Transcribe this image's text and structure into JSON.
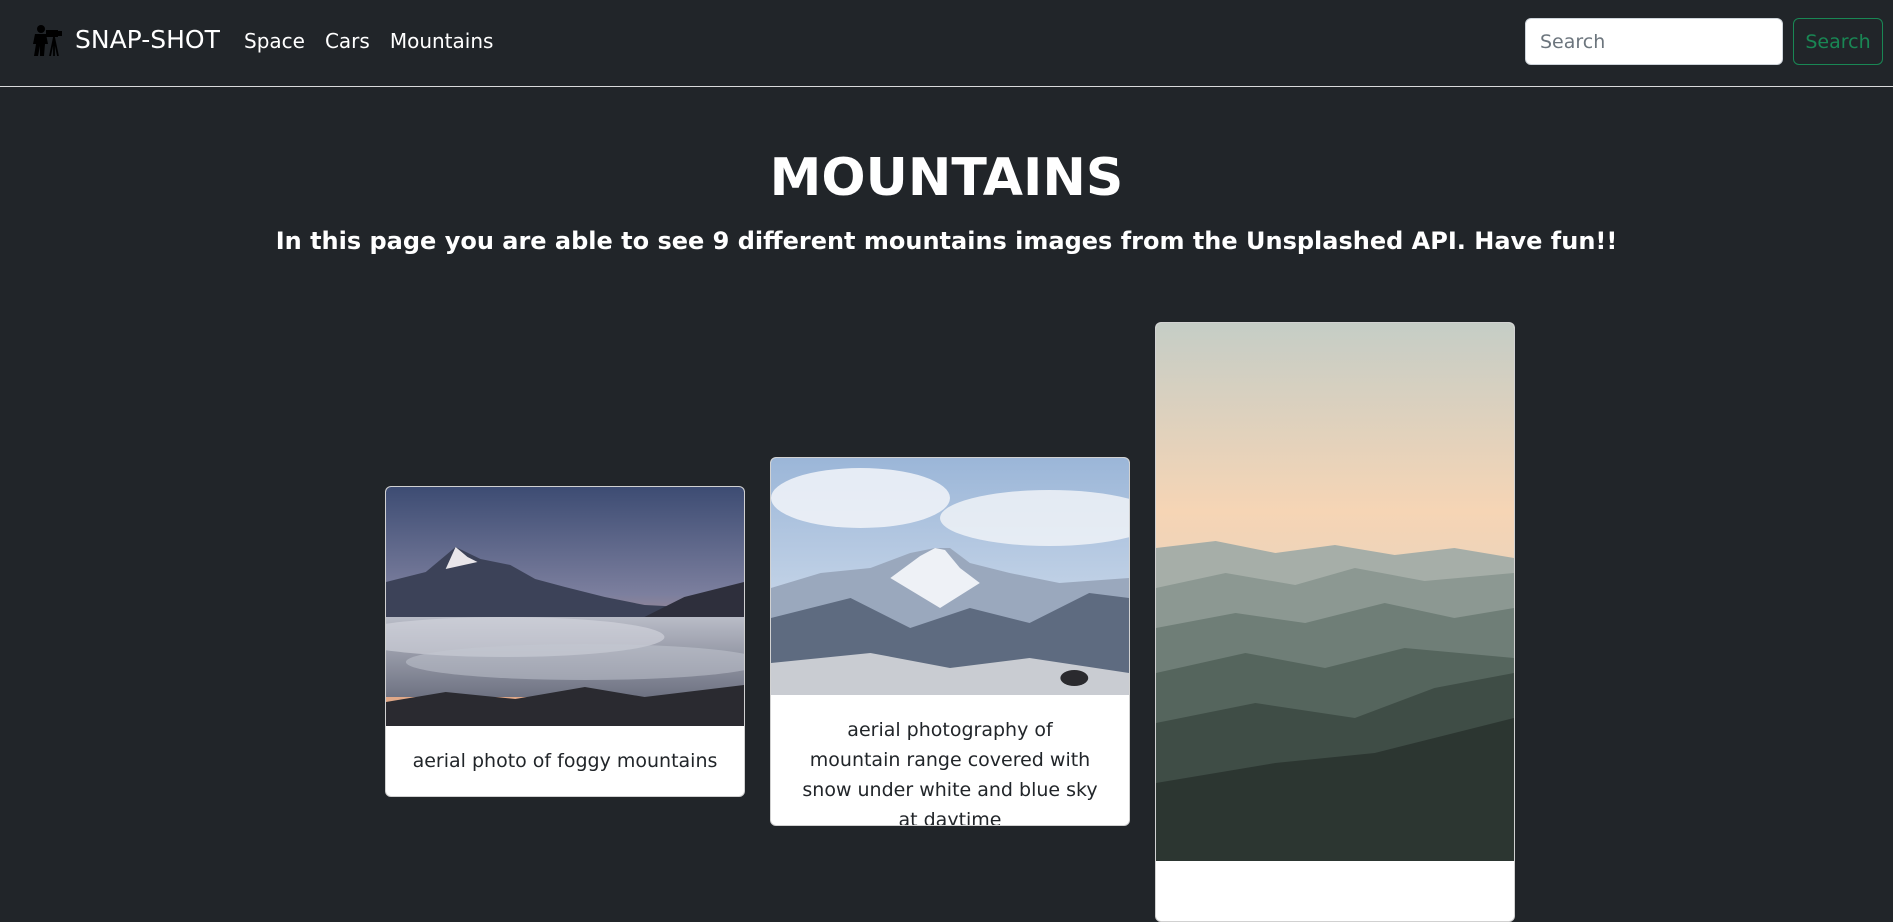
{
  "navbar": {
    "brand": "SNAP-SHOT",
    "brand_icon": "photographer-icon",
    "links": [
      {
        "label": "Space"
      },
      {
        "label": "Cars"
      },
      {
        "label": "Mountains"
      }
    ],
    "search": {
      "placeholder": "Search",
      "value": "",
      "button_label": "Search"
    }
  },
  "main": {
    "title": "MOUNTAINS",
    "subtitle": "In this page you are able to see 9 different mountains images from the Unsplashed API. Have fun!!"
  },
  "cards": [
    {
      "caption": "aerial photo of foggy mountains"
    },
    {
      "caption": "aerial photography of mountain range covered with snow under white and blue sky at daytime"
    },
    {
      "caption": ""
    }
  ],
  "colors": {
    "background": "#212529",
    "search_button": "#198754",
    "card": "#ffffff"
  }
}
